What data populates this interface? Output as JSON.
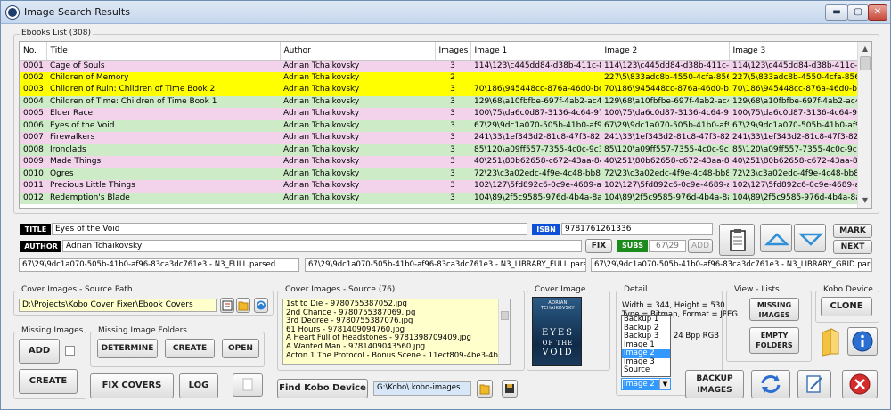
{
  "window": {
    "title": "Image Search Results",
    "min": "▬",
    "max": "▢",
    "close": "✕"
  },
  "ebooks": {
    "group_label": "Ebooks List (308)",
    "columns": [
      "No.",
      "Title",
      "Author",
      "Images",
      "Image 1",
      "Image 2",
      "Image 3"
    ],
    "rows": [
      {
        "no": "0001",
        "title": "Cage of Souls",
        "author": "Adrian Tchaikovsky",
        "images": "3",
        "img1": "114\\123\\c445dd84-d38b-411c-8...",
        "img2": "114\\123\\c445dd84-d38b-411c-8...",
        "img3": "114\\123\\c445dd84-d38b-411c-8...",
        "color": "pink"
      },
      {
        "no": "0002",
        "title": "Children of Memory",
        "author": "Adrian Tchaikovsky",
        "images": "2",
        "img1": "",
        "img2": "227\\5\\833adc8b-4550-4cfa-8564...",
        "img3": "227\\5\\833adc8b-4550-4cfa-8564...",
        "color": "yellow"
      },
      {
        "no": "0003",
        "title": "Children of Ruin: Children of Time Book 2",
        "author": "Adrian Tchaikovsky",
        "images": "3",
        "img1": "70\\186\\945448cc-876a-46d0-bd...",
        "img2": "70\\186\\945448cc-876a-46d0-bd...",
        "img3": "70\\186\\945448cc-876a-46d0-bd...",
        "color": "yellow"
      },
      {
        "no": "0004",
        "title": "Children of Time: Children of Time Book 1",
        "author": "Adrian Tchaikovsky",
        "images": "3",
        "img1": "129\\68\\a10fbfbe-697f-4ab2-ac4...",
        "img2": "129\\68\\a10fbfbe-697f-4ab2-ac4...",
        "img3": "129\\68\\a10fbfbe-697f-4ab2-ac4...",
        "color": "green"
      },
      {
        "no": "0005",
        "title": "Elder Race",
        "author": "Adrian Tchaikovsky",
        "images": "3",
        "img1": "100\\75\\da6c0d87-3136-4c64-97...",
        "img2": "100\\75\\da6c0d87-3136-4c64-97...",
        "img3": "100\\75\\da6c0d87-3136-4c64-97...",
        "color": "pink"
      },
      {
        "no": "0006",
        "title": "Eyes of the Void",
        "author": "Adrian Tchaikovsky",
        "images": "3",
        "img1": "67\\29\\9dc1a070-505b-41b0-af9...",
        "img2": "67\\29\\9dc1a070-505b-41b0-af9...",
        "img3": "67\\29\\9dc1a070-505b-41b0-af9...",
        "color": "green"
      },
      {
        "no": "0007",
        "title": "Firewalkers",
        "author": "Adrian Tchaikovsky",
        "images": "3",
        "img1": "241\\33\\1ef343d2-81c8-47f3-820...",
        "img2": "241\\33\\1ef343d2-81c8-47f3-820...",
        "img3": "241\\33\\1ef343d2-81c8-47f3-820...",
        "color": "pink"
      },
      {
        "no": "0008",
        "title": "Ironclads",
        "author": "Adrian Tchaikovsky",
        "images": "3",
        "img1": "85\\120\\a09ff557-7355-4c0c-9c3...",
        "img2": "85\\120\\a09ff557-7355-4c0c-9c3...",
        "img3": "85\\120\\a09ff557-7355-4c0c-9c3...",
        "color": "green"
      },
      {
        "no": "0009",
        "title": "Made Things",
        "author": "Adrian Tchaikovsky",
        "images": "3",
        "img1": "40\\251\\80b62658-c672-43aa-84...",
        "img2": "40\\251\\80b62658-c672-43aa-84...",
        "img3": "40\\251\\80b62658-c672-43aa-84...",
        "color": "pink"
      },
      {
        "no": "0010",
        "title": "Ogres",
        "author": "Adrian Tchaikovsky",
        "images": "3",
        "img1": "72\\23\\c3a02edc-4f9e-4c48-bb8...",
        "img2": "72\\23\\c3a02edc-4f9e-4c48-bb8...",
        "img3": "72\\23\\c3a02edc-4f9e-4c48-bb8...",
        "color": "green"
      },
      {
        "no": "0011",
        "title": "Precious Little Things",
        "author": "Adrian Tchaikovsky",
        "images": "3",
        "img1": "102\\127\\5fd892c6-0c9e-4689-af...",
        "img2": "102\\127\\5fd892c6-0c9e-4689-af...",
        "img3": "102\\127\\5fd892c6-0c9e-4689-af...",
        "color": "pink"
      },
      {
        "no": "0012",
        "title": "Redemption's Blade",
        "author": "Adrian Tchaikovsky",
        "images": "3",
        "img1": "104\\89\\2f5c9585-976d-4b4a-8a6...",
        "img2": "104\\89\\2f5c9585-976d-4b4a-8a6...",
        "img3": "104\\89\\2f5c9585-976d-4b4a-8a6...",
        "color": "green"
      }
    ]
  },
  "details": {
    "title_label": "TITLE",
    "title_value": "Eyes of the Void",
    "author_label": "AUTHOR",
    "author_value": "Adrian Tchaikovsky",
    "isbn_label": "ISBN",
    "isbn_value": "9781761261336",
    "fix_label": "FIX",
    "subs_label": "SUBS",
    "subs_value": "67\\29",
    "add_label": "ADD",
    "mark_label": "MARK",
    "next_label": "NEXT",
    "path1": "67\\29\\9dc1a070-505b-41b0-af96-83ca3dc761e3 - N3_FULL.parsed",
    "path2": "67\\29\\9dc1a070-505b-41b0-af96-83ca3dc761e3 - N3_LIBRARY_FULL.parsed",
    "path3": "67\\29\\9dc1a070-505b-41b0-af96-83ca3dc761e3 - N3_LIBRARY_GRID.parsed"
  },
  "source_path": {
    "group_label": "Cover Images - Source Path",
    "value": "D:\\Projects\\Kobo Cover Fixer\\Ebook Covers"
  },
  "cover_source": {
    "group_label": "Cover Images - Source (76)",
    "items": [
      "1st to Die - 9780755387052.jpg",
      "2nd Chance - 9780755387069.jpg",
      "3rd Degree - 9780755387076.jpg",
      "61 Hours - 9781409094760.jpg",
      "A Heart Full of Headstones - 9781398709409.jpg",
      "A Wanted Man - 9781409043560.jpg",
      "Acton 1 The Protocol - Bonus Scene - 11ecf809-4be3-4bd2-b917-..."
    ]
  },
  "cover_image": {
    "group_label": "Cover Image",
    "author": "ADRIAN TCHAIKOVSKY",
    "line1": "EYES",
    "line2": "OF THE",
    "line3": "VOID"
  },
  "detail": {
    "group_label": "Detail",
    "line1": "Width = 344, Height = 530.",
    "line2": "Type = Bitmap, Format = JPEG",
    "line3": "24 Bpp RGB",
    "options": [
      "Backup 1",
      "Backup 2",
      "Backup 3",
      "Image 1",
      "Image 2",
      "Image 3",
      "Source"
    ],
    "selected": "Image 2"
  },
  "view_lists": {
    "group_label": "View - Lists",
    "missing_images": "MISSING IMAGES",
    "empty_folders": "EMPTY FOLDERS"
  },
  "kobo_device": {
    "group_label": "Kobo Device",
    "clone": "CLONE"
  },
  "missing_images": {
    "group_label": "Missing Images",
    "add": "ADD",
    "create": "CREATE"
  },
  "missing_folders": {
    "group_label": "Missing Image Folders",
    "determine": "DETERMINE",
    "create": "CREATE",
    "open": "OPEN"
  },
  "bottom": {
    "fix_covers": "FIX COVERS",
    "log": "LOG",
    "find_kobo": "Find Kobo Device",
    "kobo_path": "G:\\Kobo\\.kobo-images",
    "backup_images": "BACKUP IMAGES"
  },
  "colors": {
    "pink": "#f3d3ec",
    "green": "#cdebc6",
    "yellow": "#ffff00",
    "blue_label": "#0d4fd6",
    "subs_green": "#1b8c1b"
  }
}
